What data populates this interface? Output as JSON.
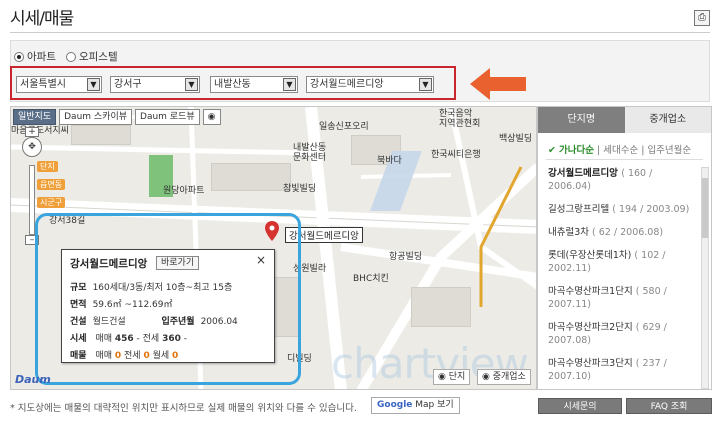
{
  "page": {
    "title": "시세/매물"
  },
  "filters": {
    "radios": [
      {
        "label": "아파트",
        "selected": true
      },
      {
        "label": "오피스텔",
        "selected": false
      }
    ],
    "city": "서울특별시",
    "district": "강서구",
    "dong": "내발산동",
    "complex": "강서월드메르디앙"
  },
  "map": {
    "tools": {
      "normal": "일반지도",
      "skyview": "Daum 스카이뷰",
      "roadview": "Daum 로드뷰"
    },
    "zoom_tags": [
      "단지",
      "읍면동",
      "시군구"
    ],
    "labels": {
      "school_top": "일송신포오리",
      "music_school": "한국음악\n지역관현회",
      "baekdu": "백상빌딩",
      "center": "내발산동\n문화센터",
      "bank": "한국씨티은행",
      "welwon": "원당아파트",
      "champ": "참빛빌딩",
      "bukdong": "북바다",
      "gangseo": "강서38길",
      "hanggong": "항공빌딩",
      "bhc": "BHC치킨",
      "seongwon": "성원빌라",
      "dibuilding": "디빌딩",
      "left_top": "마음공도서지씨"
    },
    "marker_label": "강서월드메르디앙",
    "watermark": "chartview",
    "logo": "Daum",
    "bottom_buttons": {
      "complex": "단지",
      "agent": "중개업소"
    }
  },
  "callout": {
    "title": "강서월드메르디앙",
    "go_label": "바로가기",
    "close": "×",
    "rows": {
      "scale_label": "규모",
      "scale_value": "160세대/3동/최저 10층~최고 15층",
      "area_label": "면적",
      "area_value": "59.6㎡ ~112.69㎡",
      "build_label": "건설",
      "build_value": "월드건설",
      "movein_label": "입주년월",
      "movein_value": "2006.04",
      "price_label": "시세",
      "price_sale_label": "매매",
      "price_sale_value": "456",
      "price_jeonse_label": "전세",
      "price_jeonse_value": "360",
      "listing_label": "매물",
      "listing_sale_value": "0",
      "listing_jeonse_value": "0",
      "listing_monthly_label": "월세",
      "listing_monthly_value": "0"
    }
  },
  "panel": {
    "tab_complex": "단지명",
    "tab_agent": "중개업소",
    "sort_name": "가나다순",
    "sort_household": "세대수순",
    "sort_movein": "입주년월순",
    "list": [
      {
        "name": "강서월드메르디앙",
        "info": "( 160 / 2006.04)"
      },
      {
        "name": "길성그랑프리텔",
        "info": "( 194 / 2003.09)"
      },
      {
        "name": "내츄럴3차",
        "info": "( 62 / 2006.08)"
      },
      {
        "name": "롯데(우장산롯데1차)",
        "info": "( 102 / 2002.11)"
      },
      {
        "name": "마곡수명산파크1단지",
        "info": "( 580 / 2007.11)"
      },
      {
        "name": "마곡수명산파크2단지",
        "info": "( 629 / 2007.08)"
      },
      {
        "name": "마곡수명산파크3단지",
        "info": "( 237 / 2007.10)"
      }
    ]
  },
  "footer": {
    "note": "* 지도상에는 매물의 대략적인 위치만 표시하므로 실제 매물의 위치와 다를 수 있습니다.",
    "google_brand": "Google",
    "google_rest": "Map 보기",
    "price_inquiry": "시세문의",
    "faq": "FAQ 조회"
  }
}
